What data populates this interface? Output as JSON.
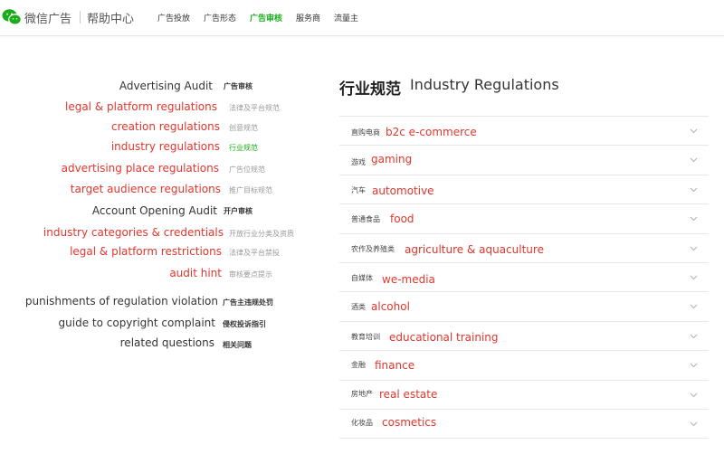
{
  "header": {
    "brand": "微信广告",
    "help": "帮助中心",
    "nav": [
      {
        "label": "广告投放"
      },
      {
        "label": "广告形态"
      },
      {
        "label": "广告审核"
      },
      {
        "label": "服务商"
      },
      {
        "label": "流量主"
      }
    ],
    "active_nav": "广告审核"
  },
  "sidebar": {
    "items": [
      {
        "en": "Advertising Audit",
        "cn": "广告审核"
      },
      {
        "en": "legal & platform regulations",
        "cn": "法律及平台规范"
      },
      {
        "en": "creation regulations",
        "cn": "创意规范"
      },
      {
        "en": "industry regulations",
        "cn": "行业规范"
      },
      {
        "en": "advertising place regulations",
        "cn": "广告位规范"
      },
      {
        "en": "target audience regulations",
        "cn": "推广目标规范"
      },
      {
        "en": "Account Opening Audit",
        "cn": "开户审核"
      },
      {
        "en": "industry categories & credentials",
        "cn": "开放行业分类及资质"
      },
      {
        "en": "legal & platform restrictions",
        "cn": "法律及平台禁投"
      },
      {
        "en": "audit hint",
        "cn": "审核要点提示"
      },
      {
        "en": "punishments of regulation violation",
        "cn": "广告主违规处罚"
      },
      {
        "en": "guide to copyright complaint",
        "cn": "侵权投诉指引"
      },
      {
        "en": "related questions",
        "cn": "相关问题"
      }
    ]
  },
  "main": {
    "title_cn": "行业规范",
    "title_en": "Industry Regulations",
    "rows": [
      {
        "cn": "直购电商",
        "en": "b2c e-commerce"
      },
      {
        "cn": "游戏",
        "en": "gaming"
      },
      {
        "cn": "汽车",
        "en": "automotive"
      },
      {
        "cn": "普通食品",
        "en": "food"
      },
      {
        "cn": "农作及养殖类",
        "en": "agriculture & aquaculture"
      },
      {
        "cn": "自媒体",
        "en": "we-media"
      },
      {
        "cn": "酒类",
        "en": "alcohol"
      },
      {
        "cn": "教育培训",
        "en": "educational training"
      },
      {
        "cn": "金融",
        "en": "finance"
      },
      {
        "cn": "房地产",
        "en": "real estate"
      },
      {
        "cn": "化妆品",
        "en": "cosmetics"
      }
    ]
  },
  "colors": {
    "accent_green": "#1aad19",
    "link_red": "#e0362c",
    "text_dark": "#353535",
    "border": "#e7e7eb"
  }
}
